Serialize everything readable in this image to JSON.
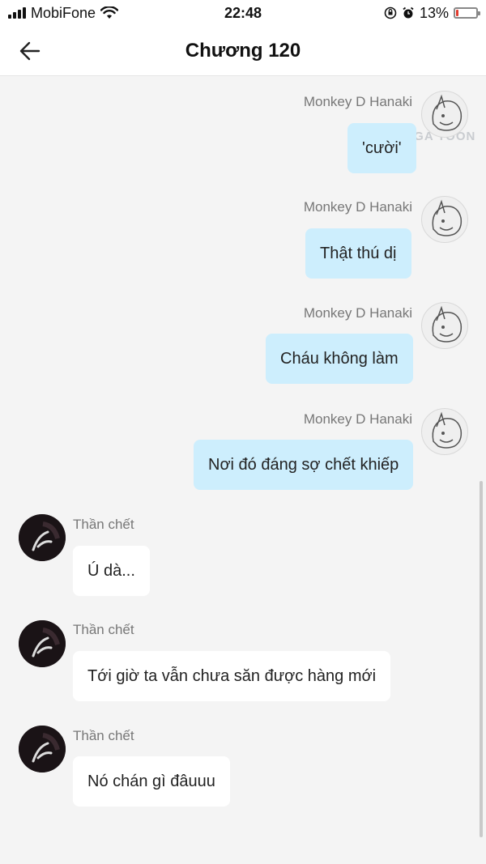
{
  "status_bar": {
    "carrier": "MobiFone",
    "time": "22:48",
    "battery": "13%",
    "battery_level": 0.13,
    "icons": [
      "signal-bars-icon",
      "wifi-icon",
      "orientation-lock-icon",
      "alarm-icon",
      "battery-icon"
    ]
  },
  "header": {
    "title": "Chương 120",
    "back_icon": "arrow-left-icon"
  },
  "watermark": "MANGA TOON",
  "messages": [
    {
      "sender": "Monkey D Hanaki",
      "text": "'cười'",
      "side": "right"
    },
    {
      "sender": "Monkey D Hanaki",
      "text": "Thật thú dị",
      "side": "right"
    },
    {
      "sender": "Monkey D Hanaki",
      "text": "Cháu không làm",
      "side": "right"
    },
    {
      "sender": "Monkey D Hanaki",
      "text": "Nơi đó đáng sợ chết khiếp",
      "side": "right"
    },
    {
      "sender": "Thần chết",
      "text": "Ú dà...",
      "side": "left"
    },
    {
      "sender": "Thần chết",
      "text": "Tới giờ ta vẫn chưa săn được hàng mới",
      "side": "left"
    },
    {
      "sender": "Thần chết",
      "text": "Nó chán gì đâuuu",
      "side": "left"
    }
  ],
  "colors": {
    "my_bubble": "#cdeefd",
    "other_bubble": "#ffffff",
    "background": "#f4f4f4",
    "battery_low": "#e23b2e"
  }
}
